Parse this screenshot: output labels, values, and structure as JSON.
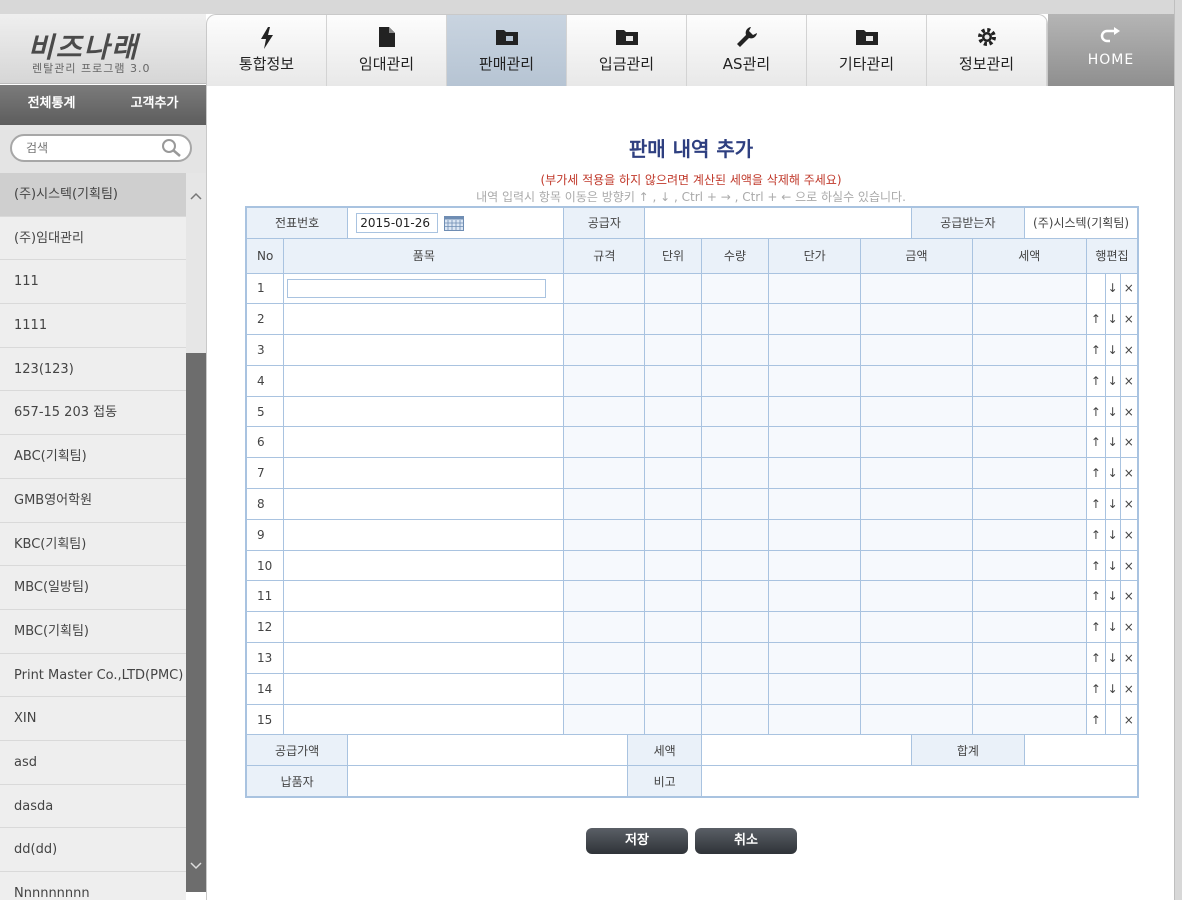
{
  "logo": {
    "title": "비즈나래",
    "subtitle": "렌탈관리 프로그램 3.0"
  },
  "nav": {
    "tabs": [
      {
        "label": "통합정보",
        "icon": "lightning-icon"
      },
      {
        "label": "임대관리",
        "icon": "document-icon"
      },
      {
        "label": "판매관리",
        "icon": "folder-icon",
        "active": true
      },
      {
        "label": "입금관리",
        "icon": "folder-icon"
      },
      {
        "label": "AS관리",
        "icon": "wrench-icon"
      },
      {
        "label": "기타관리",
        "icon": "folder-icon"
      },
      {
        "label": "정보관리",
        "icon": "gear-icon"
      }
    ],
    "home_label": "HOME"
  },
  "sidebar": {
    "total_stats_label": "전체통계",
    "add_client_label": "고객추가",
    "search_placeholder": "검색",
    "clients": [
      "(주)시스텍(기획팀)",
      "(주)임대관리",
      "111",
      "1111",
      "123(123)",
      "657-15 203 접동",
      "ABC(기획팀)",
      "GMB영어학원",
      "KBC(기획팀)",
      "MBC(일방팀)",
      "MBC(기획팀)",
      "Print Master Co.,LTD(PMC)",
      "XIN",
      "asd",
      "dasda",
      "dd(dd)",
      "Nnnnnnnnn"
    ]
  },
  "form": {
    "title": "판매 내역 추가",
    "warning": "(부가세 적용을 하지 않으려면 계산된 세액을 삭제해 주세요)",
    "hint": "내역 입력시 항목 이동은 방향키 ↑ , ↓ , Ctrl + → , Ctrl + ← 으로 하실수 있습니다.",
    "slip_no_label": "전표번호",
    "date_value": "2015-01-26",
    "supplier_label": "공급자",
    "receiver_label": "공급받는자",
    "receiver_value": "(주)시스텍(기획팀)",
    "columns": {
      "no": "No",
      "item": "품목",
      "spec": "규격",
      "unit": "단위",
      "qty": "수량",
      "price": "단가",
      "amount": "금액",
      "tax": "세액",
      "edit": "행편집"
    },
    "row_numbers": [
      "1",
      "2",
      "3",
      "4",
      "5",
      "6",
      "7",
      "8",
      "9",
      "10",
      "11",
      "12",
      "13",
      "14",
      "15"
    ],
    "arrows": {
      "up": "↑",
      "down": "↓",
      "del": "×"
    },
    "supply_amount_label": "공급가액",
    "tax_label": "세액",
    "total_label": "합계",
    "deliverer_label": "납품자",
    "note_label": "비고"
  },
  "buttons": {
    "save": "저장",
    "cancel": "취소"
  }
}
